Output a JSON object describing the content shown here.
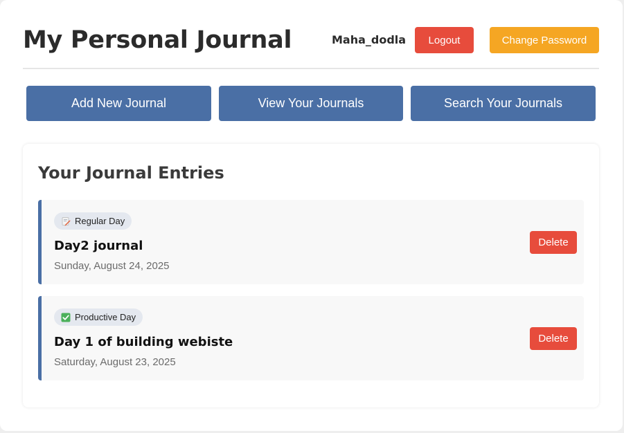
{
  "header": {
    "title": "My Personal Journal",
    "username": "Maha_dodla",
    "logout_label": "Logout",
    "change_password_label": "Change Password"
  },
  "nav": {
    "add_label": "Add New Journal",
    "view_label": "View Your Journals",
    "search_label": "Search Your Journals"
  },
  "entries_section": {
    "title": "Your Journal Entries",
    "entries": [
      {
        "mood": "Regular Day",
        "mood_icon": "memo-icon",
        "title": "Day2 journal",
        "date": "Sunday, August 24, 2025",
        "delete_label": "Delete"
      },
      {
        "mood": "Productive Day",
        "mood_icon": "check-mark-icon",
        "title": "Day 1 of building webiste",
        "date": "Saturday, August 23, 2025",
        "delete_label": "Delete"
      }
    ]
  },
  "colors": {
    "primary": "#4a6fa5",
    "danger": "#e74c3c",
    "warning": "#f5a623",
    "badge_bg": "#e4e8ef"
  }
}
